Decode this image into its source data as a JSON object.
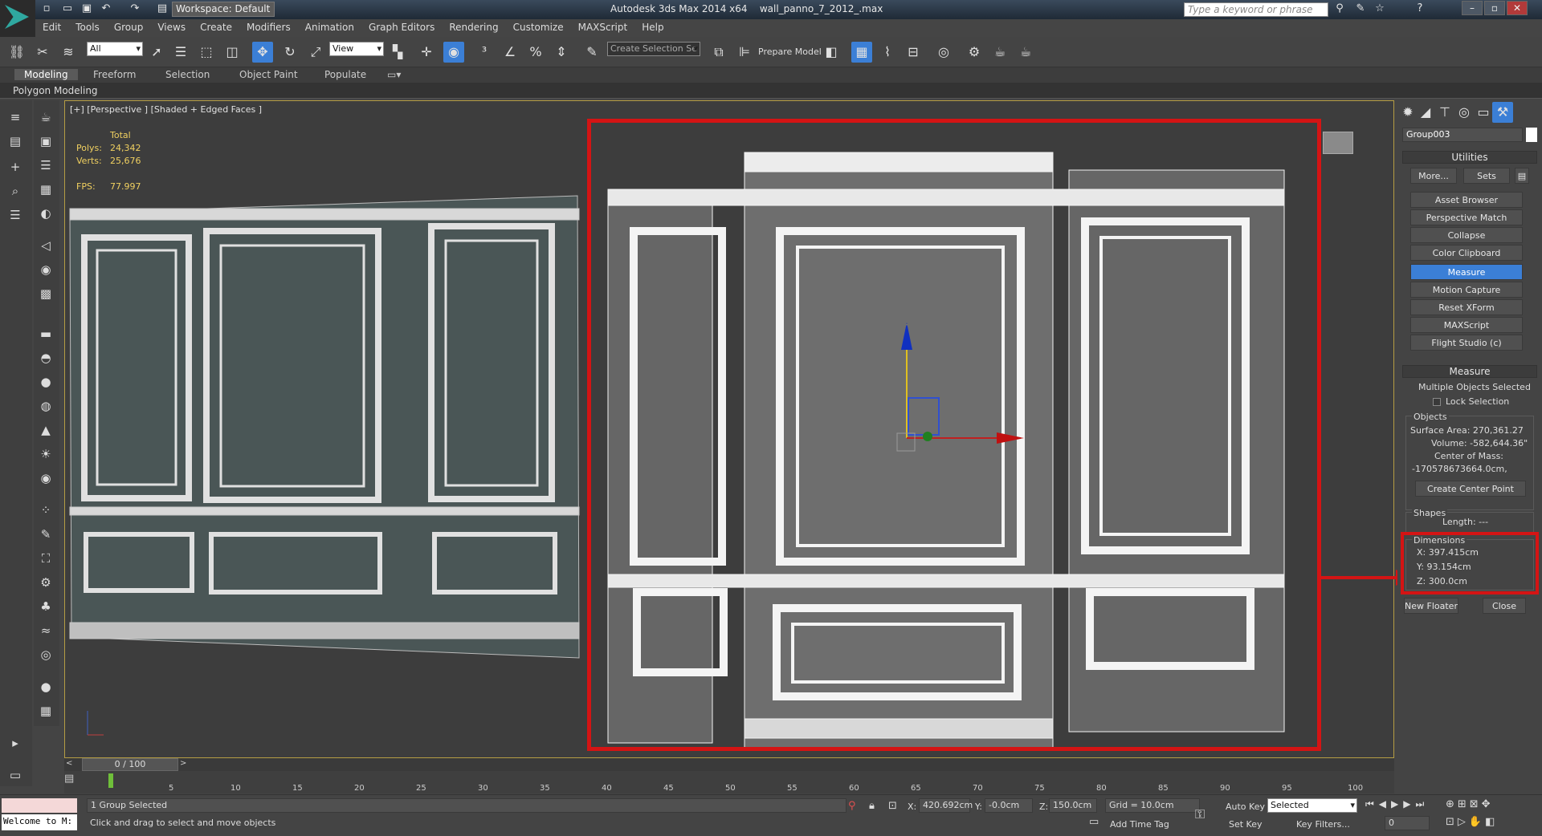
{
  "titlebar": {
    "app_title": "Autodesk 3ds Max  2014 x64",
    "file_name": "wall_panno_7_2012_.max",
    "workspace": "Workspace: Default",
    "search_placeholder": "Type a keyword or phrase"
  },
  "menu": [
    "Edit",
    "Tools",
    "Group",
    "Views",
    "Create",
    "Modifiers",
    "Animation",
    "Graph Editors",
    "Rendering",
    "Customize",
    "MAXScript",
    "Help"
  ],
  "toolbar": {
    "selection_filter": "All",
    "reference_coord": "View",
    "named_selection": "Create Selection Se",
    "prepare_model": "Prepare Model"
  },
  "ribbon": {
    "tabs": [
      "Modeling",
      "Freeform",
      "Selection",
      "Object Paint",
      "Populate"
    ],
    "active_tab": "Modeling",
    "panel_label": "Polygon Modeling"
  },
  "viewport": {
    "label": "[+] [Perspective ] [Shaded + Edged Faces ]",
    "stats_header": "Total",
    "polys_label": "Polys:",
    "polys_value": "24,342",
    "verts_label": "Verts:",
    "verts_value": "25,676",
    "fps_label": "FPS:",
    "fps_value": "77.997"
  },
  "command_panel": {
    "object_name": "Group003",
    "utilities_title": "Utilities",
    "more_button": "More...",
    "sets_button": "Sets",
    "utility_buttons": [
      "Asset Browser",
      "Perspective Match",
      "Collapse",
      "Color Clipboard",
      "Measure",
      "Motion Capture",
      "Reset XForm",
      "MAXScript",
      "Flight Studio (c)"
    ],
    "active_utility": "Measure",
    "measure": {
      "title": "Measure",
      "selection_text": "Multiple Objects Selected",
      "lock_selection": "Lock Selection",
      "objects_group": "Objects",
      "surface_area": "Surface Area:  270,361.27",
      "volume": "Volume:  -582,644.36\"",
      "center_of_mass": "Center of Mass:",
      "center_value": "-170578673664.0cm,",
      "create_center_point": "Create Center Point",
      "shapes_group": "Shapes",
      "length": "Length: ---",
      "dimensions_group": "Dimensions",
      "dim_x": "X:  397.415cm",
      "dim_y": "Y:  93.154cm",
      "dim_z": "Z:  300.0cm",
      "new_floater": "New Floater",
      "close": "Close"
    }
  },
  "timeline": {
    "frame": "0 / 100",
    "ticks": [
      "5",
      "10",
      "15",
      "20",
      "25",
      "30",
      "35",
      "40",
      "45",
      "50",
      "55",
      "60",
      "65",
      "70",
      "75",
      "80",
      "85",
      "90",
      "95",
      "100"
    ]
  },
  "status": {
    "maxscript_listener": "Welcome to M:",
    "selection": "1 Group Selected",
    "prompt": "Click and drag to select and move objects",
    "x_label": "X:",
    "x_value": "420.692cm",
    "y_label": "Y:",
    "y_value": "-0.0cm",
    "z_label": "Z:",
    "z_value": "150.0cm",
    "grid": "Grid = 10.0cm",
    "add_time_tag": "Add Time Tag",
    "auto_key": "Auto Key",
    "set_key": "Set Key",
    "key_mode": "Selected",
    "key_filters": "Key Filters...",
    "current_frame": "0"
  },
  "colors": {
    "highlight_red": "#d41414",
    "active_blue": "#3b7fd6",
    "viewport_bg": "#3d3d3d"
  }
}
